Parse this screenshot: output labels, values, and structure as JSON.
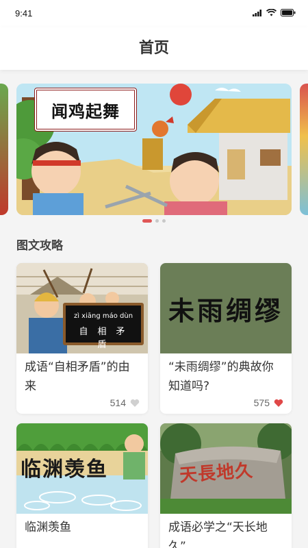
{
  "status_bar": {
    "time": "9:41"
  },
  "header": {
    "title": "首页"
  },
  "carousel": {
    "banner_title": "闻鸡起舞",
    "page_count": 3,
    "active_index": 0
  },
  "section": {
    "title": "图文攻略"
  },
  "cards": [
    {
      "title": "成语“自相矛盾”的由来",
      "likes": "514",
      "liked": false,
      "image_pinyin": "zì xiāng máo dùn",
      "image_chars": "自相矛盾"
    },
    {
      "title": "“未雨绸缪”的典故你知道吗?",
      "likes": "575",
      "liked": true,
      "image_text": "未雨绸缪"
    },
    {
      "title": "临渊羡鱼",
      "image_text": "临渊羡鱼"
    },
    {
      "title": "成语必学之“天长地久”",
      "image_text": "天長地久"
    }
  ],
  "colors": {
    "accent": "#e05656",
    "like_active": "#e04848",
    "like_inactive": "#d0d0d0"
  }
}
